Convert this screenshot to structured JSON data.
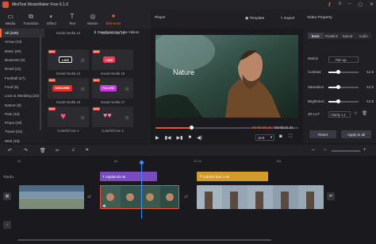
{
  "app": {
    "title": "MiniTool MovieMaker Free 6.1.0"
  },
  "media_tabs": [
    {
      "label": "Media",
      "icon": "folder-icon"
    },
    {
      "label": "Transition",
      "icon": "transition-icon"
    },
    {
      "label": "Effect",
      "icon": "effect-icon"
    },
    {
      "label": "Text",
      "icon": "text-icon"
    },
    {
      "label": "Motion",
      "icon": "motion-icon"
    },
    {
      "label": "Elements",
      "icon": "elements-icon"
    }
  ],
  "categories": [
    "All (229)",
    "Arrow (23)",
    "Basic (20)",
    "Business (5)",
    "Email (11)",
    "Football (27)",
    "Food (8)",
    "Love & Wedding (23)",
    "Nature (8)",
    "Pets (13)",
    "Props (28)",
    "Travel (33)",
    "Web (19)"
  ],
  "download_youtube_label": "Download YouTube Videos",
  "elements": [
    {
      "label": "Social media 12",
      "sticker": ""
    },
    {
      "label": "Social media 13",
      "sticker": ""
    },
    {
      "label": "Social media 14",
      "sticker": "LIKE"
    },
    {
      "label": "Social media 15",
      "sticker": "LIKE"
    },
    {
      "label": "Social media 16",
      "sticker": "SUBSCRIBE"
    },
    {
      "label": "Social media 17",
      "sticker": "FOLLOW"
    },
    {
      "label": "Colorful love 1",
      "sticker": ""
    },
    {
      "label": "Colorful love 2",
      "sticker": ""
    }
  ],
  "new_badge": "NEW",
  "player": {
    "label": "Player",
    "template_label": "Template",
    "export_label": "Export",
    "overlay_text": "Nature",
    "time_current": "00:00:05.10",
    "time_total": "00:00:21.01",
    "aspect_ratio": "16:9",
    "progress": 0.25
  },
  "properties": {
    "title": "Video Property",
    "tabs": [
      "Basic",
      "Rotation",
      "Speed",
      "Audio"
    ],
    "motion_label": "Motion",
    "motion_value": "Pan up",
    "contrast_label": "Contrast",
    "contrast_value": "-12.5",
    "contrast_level": 0.33,
    "saturation_label": "Saturation",
    "saturation_value": "-12.5",
    "saturation_level": 0.33,
    "brightness_label": "Brightness",
    "brightness_value": "-12.5",
    "brightness_level": 0.33,
    "lut_label": "3D LUT",
    "lut_value": "Clarity 1.1",
    "reset_label": "Reset",
    "apply_label": "Apply to all"
  },
  "timeline": {
    "ruler": [
      "0s",
      "6s",
      "12.1s",
      "18s"
    ],
    "track1_label": "Track1",
    "caption_clip": "Caption23",
    "caption_duration": "4s",
    "love_clip": "Colorful love 1",
    "love_duration": "5s"
  },
  "colors": {
    "accent": "#f3693a",
    "caption_clip": "#7a4bbf",
    "element_clip": "#d49a2a",
    "playhead": "#3a8cff"
  }
}
